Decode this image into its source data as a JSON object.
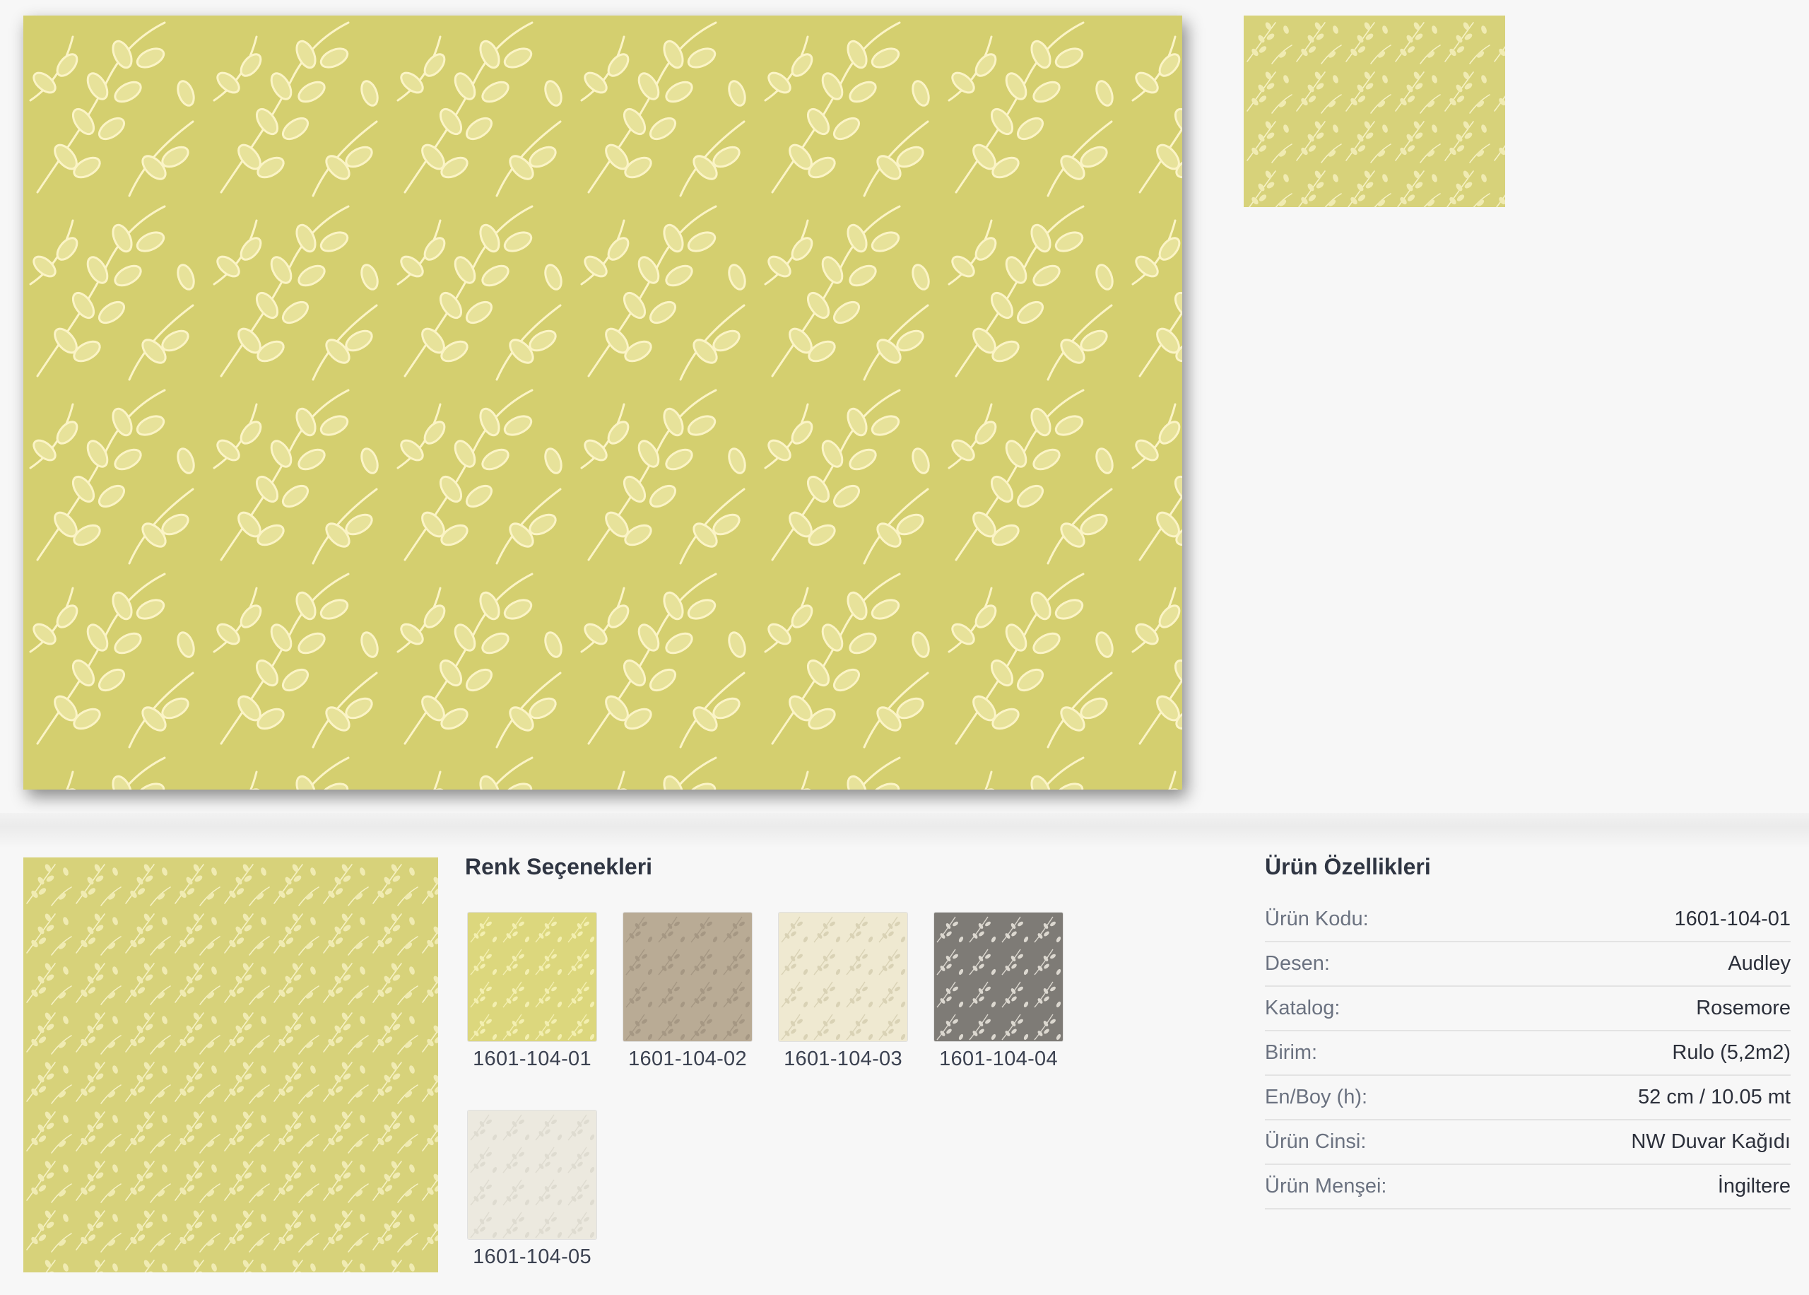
{
  "images": {
    "main": {
      "alt": "Audley 1601-104-01"
    },
    "thumbnail": {
      "alt": "1601-104-01"
    },
    "room": {
      "alt": "1601-104-01"
    }
  },
  "colors": {
    "accent_yellow": "#d4cf6f",
    "leaf_cream": "#fbf4c6",
    "heading": "#2f3542",
    "label_grey": "#6b7280"
  },
  "color_options": {
    "title": "Renk Seçenekleri",
    "items": [
      {
        "code": "1601-104-01",
        "bg": "#dcd77d",
        "leaf": "#f3efb0"
      },
      {
        "code": "1601-104-02",
        "bg": "#b9ab95",
        "leaf": "#a59783"
      },
      {
        "code": "1601-104-03",
        "bg": "#efe9d1",
        "leaf": "#d9d2b5"
      },
      {
        "code": "1601-104-04",
        "bg": "#7e7b76",
        "leaf": "#dcd8d0"
      },
      {
        "code": "1601-104-05",
        "bg": "#ece9df",
        "leaf": "#dedbd0"
      }
    ]
  },
  "properties": {
    "title": "Ürün Özellikleri",
    "rows": [
      {
        "label": "Ürün Kodu:",
        "value": "1601-104-01"
      },
      {
        "label": "Desen:",
        "value": "Audley"
      },
      {
        "label": "Katalog:",
        "value": "Rosemore"
      },
      {
        "label": "Birim:",
        "value": "Rulo (5,2m2)"
      },
      {
        "label": "En/Boy (h):",
        "value": "52 cm / 10.05 mt"
      },
      {
        "label": "Ürün Cinsi:",
        "value": "NW Duvar Kağıdı"
      },
      {
        "label": "Ürün Menşei:",
        "value": "İngiltere"
      }
    ]
  }
}
